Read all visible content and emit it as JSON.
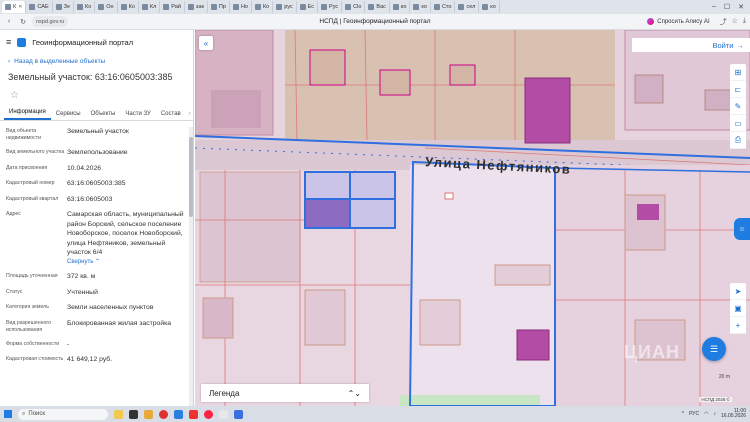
{
  "browser": {
    "tabs": [
      {
        "label": "К",
        "active": true
      },
      {
        "label": "САЕ"
      },
      {
        "label": "Зе"
      },
      {
        "label": "Ко"
      },
      {
        "label": "Он"
      },
      {
        "label": "Ко"
      },
      {
        "label": "Кл"
      },
      {
        "label": "Рай"
      },
      {
        "label": "зак"
      },
      {
        "label": "Пр"
      },
      {
        "label": "Но"
      },
      {
        "label": "Ко"
      },
      {
        "label": "рус"
      },
      {
        "label": "Ес"
      },
      {
        "label": "Рус"
      },
      {
        "label": "Сlo"
      },
      {
        "label": "Вас"
      },
      {
        "label": "ко"
      },
      {
        "label": "ко"
      },
      {
        "label": "Сто"
      },
      {
        "label": "сел"
      },
      {
        "label": "ко"
      }
    ],
    "url": "nspd.gov.ru",
    "page_title": "НСПД | Геоинформационный портал",
    "alice_label": "Спросить Алису AI"
  },
  "panel": {
    "portal_title": "Геоинформационный портал",
    "back_label": "Назад в выделенные объекты",
    "object_title": "Земельный участок: 63:16:0605003:385",
    "tabs": [
      "Информация",
      "Сервисы",
      "Объекты",
      "Части ЗУ",
      "Состав"
    ],
    "properties": [
      {
        "key": "Вид объекта недвижимости",
        "value": "Земельный участок"
      },
      {
        "key": "Вид земельного участка",
        "value": "Землепользование"
      },
      {
        "key": "Дата присвоения",
        "value": "10.04.2026"
      },
      {
        "key": "Кадастровый номер",
        "value": "63:16:0605003:385"
      },
      {
        "key": "Кадастровый квартал",
        "value": "63:16:0605003"
      },
      {
        "key": "Адрес",
        "value": "Самарская область, муниципальный район Борский, сельское поселение Новоборское, поселок Новоборский, улица Нефтяников, земельный участок 6/4"
      },
      {
        "key": "Площадь уточненная",
        "value": "372 кв. м"
      },
      {
        "key": "Статус",
        "value": "Учтенный"
      },
      {
        "key": "Категория земель",
        "value": "Земли населенных пунктов"
      },
      {
        "key": "Вид разрешенного использования",
        "value": "Блокированная жилая застройка"
      },
      {
        "key": "Форма собственности",
        "value": "-"
      },
      {
        "key": "Кадастровая стоимость",
        "value": "41 649,12 руб."
      }
    ],
    "collapse_link": "Свернуть"
  },
  "map": {
    "login_label": "Войти",
    "street_label": "Улица Нефтяников",
    "legend_label": "Легенда",
    "watermark": "ЦИАН",
    "attribution": "НСПД 2026 ©",
    "scale": "20 m",
    "parcel_color": "#2f6fe0",
    "building_color": "#b24ca5"
  },
  "taskbar": {
    "search_placeholder": "Поиск",
    "lang": "РУС",
    "time": "11:00",
    "date": "16.05.2026"
  }
}
